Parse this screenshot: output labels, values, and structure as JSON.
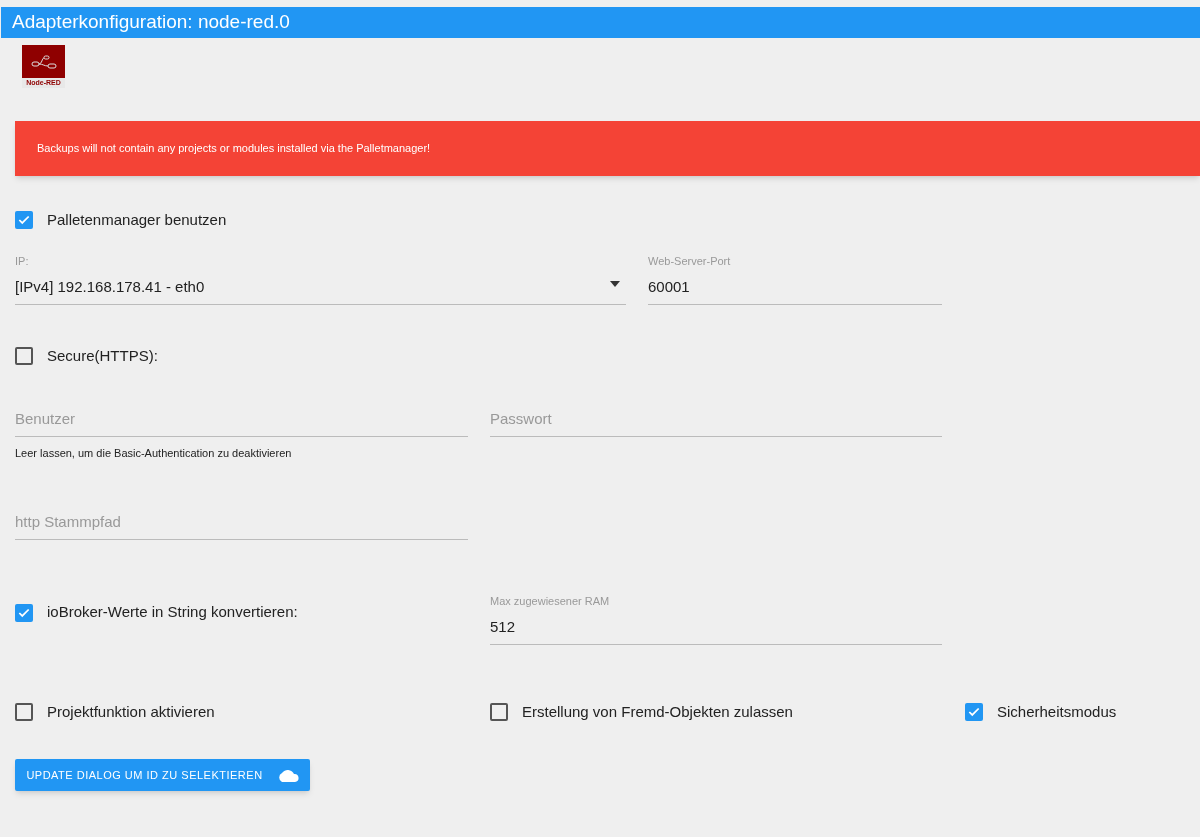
{
  "window": {
    "title": "Adapterkonfiguration: node-red.0"
  },
  "logo": {
    "label": "Node-RED"
  },
  "alert": {
    "text": "Backups will not contain any projects or modules installed via the Palletmanager!"
  },
  "palette": {
    "label": "Palletenmanager benutzen",
    "checked": true
  },
  "ip": {
    "label": "IP:",
    "value": "[IPv4] 192.168.178.41 - eth0"
  },
  "port": {
    "label": "Web-Server-Port",
    "value": "60001"
  },
  "secure": {
    "label": "Secure(HTTPS):",
    "checked": false
  },
  "user": {
    "placeholder": "Benutzer",
    "helper": "Leer lassen, um die Basic-Authentication zu deaktivieren"
  },
  "password": {
    "placeholder": "Passwort"
  },
  "root_path": {
    "placeholder": "http Stammpfad"
  },
  "convert": {
    "label": "ioBroker-Werte in String konvertieren:",
    "checked": true
  },
  "ram": {
    "label": "Max zugewiesener RAM",
    "value": "512"
  },
  "options": [
    {
      "label": "Projektfunktion aktivieren",
      "checked": false
    },
    {
      "label": "Erstellung von Fremd-Objekten zulassen",
      "checked": false
    },
    {
      "label": "Sicherheitsmodus",
      "checked": true
    }
  ],
  "button": {
    "label": "UPDATE DIALOG UM ID ZU SELEKTIEREN"
  }
}
